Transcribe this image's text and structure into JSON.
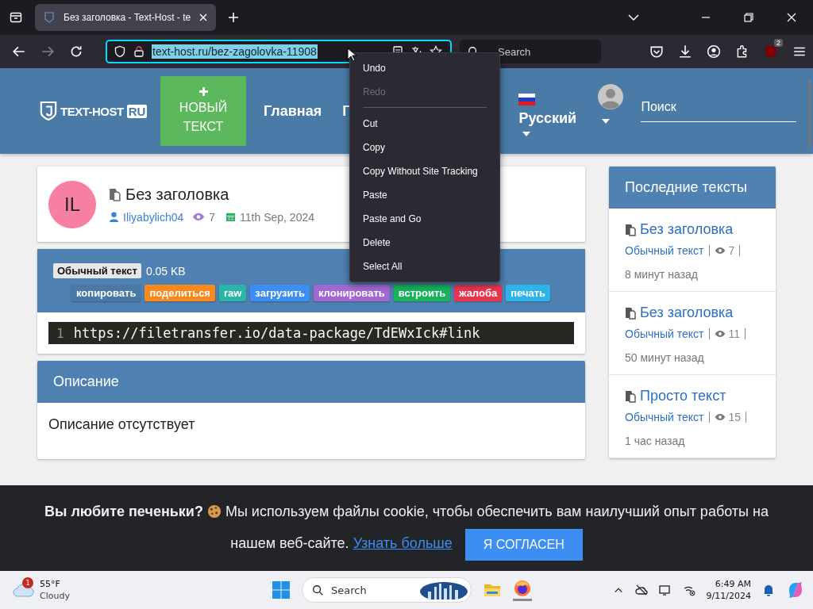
{
  "browser": {
    "tab": {
      "title": "Без заголовка - Text-Host - te",
      "selected": true
    },
    "address": "text-host.ru/bez-zagolovka-11908",
    "address_selected": true,
    "search_placeholder": "Search",
    "forward_disabled": true,
    "extension_badge": "2"
  },
  "context_menu": [
    {
      "kind": "item",
      "label": "Undo",
      "disabled": false
    },
    {
      "kind": "item",
      "label": "Redo",
      "disabled": true
    },
    {
      "kind": "separator"
    },
    {
      "kind": "item",
      "label": "Cut",
      "disabled": false
    },
    {
      "kind": "item",
      "label": "Copy",
      "disabled": false
    },
    {
      "kind": "item",
      "label": "Copy Without Site Tracking",
      "disabled": false
    },
    {
      "kind": "item",
      "label": "Paste",
      "disabled": false
    },
    {
      "kind": "item",
      "label": "Paste and Go",
      "disabled": false
    },
    {
      "kind": "item",
      "label": "Delete",
      "disabled": false
    },
    {
      "kind": "item",
      "label": "Select All",
      "disabled": false
    }
  ],
  "header": {
    "logo": "TEXT-HOST",
    "logo_suffix": "RU",
    "new_button": "НОВЫЙ ТЕКСТ",
    "nav": [
      "Главная",
      "Г"
    ],
    "language": "Русский",
    "search_placeholder": "Поиск"
  },
  "paste": {
    "avatar": "IL",
    "title": "Без заголовка",
    "author": "Iliyabylich04",
    "views": "7",
    "date": "11th Sep, 2024",
    "syntax": "Обычный текст",
    "size": "0.05 KB",
    "actions": [
      {
        "label": "копировать",
        "color": "#4a79a6"
      },
      {
        "label": "поделиться",
        "color": "#f7891d"
      },
      {
        "label": "raw",
        "color": "#2bb5a6"
      },
      {
        "label": "загрузить",
        "color": "#3d8ef2"
      },
      {
        "label": "клонировать",
        "color": "#a268d2"
      },
      {
        "label": "встроить",
        "color": "#17b45a"
      },
      {
        "label": "жалоба",
        "color": "#ea3550"
      },
      {
        "label": "печать",
        "color": "#2db4ea"
      }
    ],
    "lines": [
      {
        "number": "1",
        "text": "https://filetransfer.io/data-package/TdEWxIck#link"
      }
    ]
  },
  "description": {
    "title": "Описание",
    "text": "Описание отсутствует"
  },
  "recent": {
    "title": "Последние тексты",
    "items": [
      {
        "title": "Без заголовка",
        "syntax": "Обычный текст",
        "views": "7",
        "time": "8 минут назад"
      },
      {
        "title": "Без заголовка",
        "syntax": "Обычный текст",
        "views": "11",
        "time": "50 минут назад"
      },
      {
        "title": "Просто текст",
        "syntax": "Обычный текст",
        "views": "15",
        "time": "1 час назад"
      }
    ]
  },
  "cookie": {
    "question": "Вы любите печеньки?",
    "text": "Мы используем файлы cookie, чтобы обеспечить вам наилучший опыт работы на нашем веб-сайте.",
    "link": "Узнать больше",
    "button": "Я СОГЛАСЕН"
  },
  "taskbar": {
    "weather_badge": "1",
    "temperature": "55°F",
    "condition": "Cloudy",
    "search_placeholder": "Search",
    "time": "6:49 AM",
    "date": "9/11/2024"
  }
}
